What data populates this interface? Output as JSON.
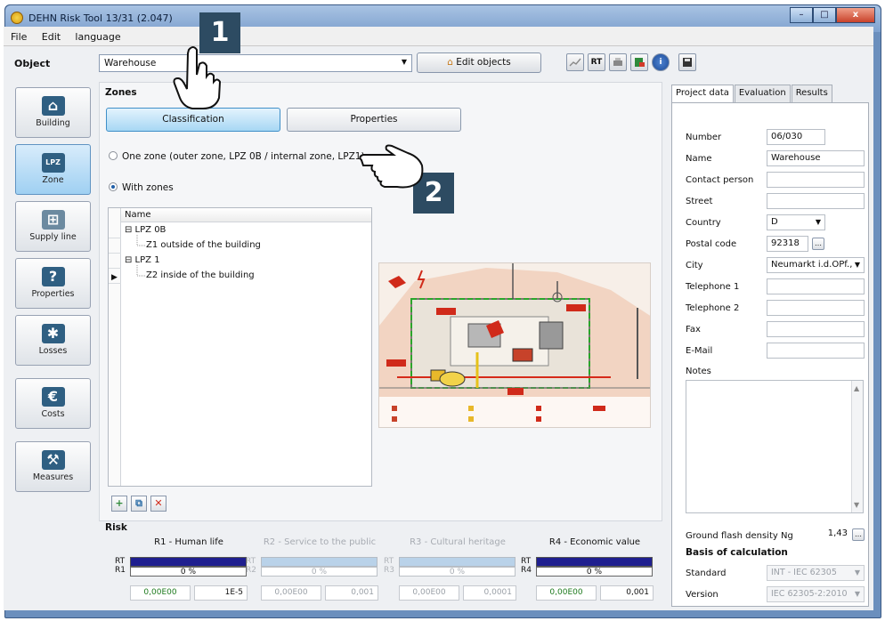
{
  "window": {
    "title": "DEHN Risk Tool 13/31 (2.047)",
    "controls": {
      "minimize": "–",
      "maximize": "□",
      "close": "x"
    }
  },
  "menu": [
    "File",
    "Edit",
    "language"
  ],
  "toolbar": {
    "object_label": "Object",
    "object_value": "Warehouse",
    "edit_objects": "Edit objects",
    "rt_label": "RT"
  },
  "sidebar": [
    {
      "label": "Building",
      "icon": "house-icon",
      "glyph": "⌂"
    },
    {
      "label": "Zone",
      "icon": "lpz-zone-icon",
      "glyph": "LPZ"
    },
    {
      "label": "Supply line",
      "icon": "supply-line-icon",
      "glyph": "⊞"
    },
    {
      "label": "Properties",
      "icon": "question-icon",
      "glyph": "?"
    },
    {
      "label": "Losses",
      "icon": "losses-icon",
      "glyph": "✱"
    },
    {
      "label": "Costs",
      "icon": "euro-icon",
      "glyph": "€"
    },
    {
      "label": "Measures",
      "icon": "wrench-icon",
      "glyph": "⚒"
    }
  ],
  "zones": {
    "heading": "Zones",
    "classification_btn": "Classification",
    "properties_btn": "Properties",
    "radio_one_zone": "One zone (outer zone, LPZ 0B / internal zone, LPZ1)",
    "radio_with_zones": "With zones",
    "tree_header": "Name",
    "tree": [
      {
        "label": "⊟ LPZ 0B",
        "indent": 0
      },
      {
        "label": "Z1 outside of the building",
        "indent": 1
      },
      {
        "label": "⊟ LPZ 1",
        "indent": 0
      },
      {
        "label": "Z2 inside of the building",
        "indent": 1
      }
    ]
  },
  "callouts": {
    "one": "1",
    "two": "2"
  },
  "risk": {
    "heading": "Risk",
    "items": [
      {
        "title": "R1 - Human life",
        "rt": "RT",
        "rn": "R1",
        "percent": "0 %",
        "value": "0,00E00",
        "limit": "1E-5",
        "active": true
      },
      {
        "title": "R2 - Service to the public",
        "rt": "RT",
        "rn": "R2",
        "percent": "0 %",
        "value": "0,00E00",
        "limit": "0,001",
        "active": false
      },
      {
        "title": "R3 - Cultural heritage",
        "rt": "RT",
        "rn": "R3",
        "percent": "0 %",
        "value": "0,00E00",
        "limit": "0,0001",
        "active": false
      },
      {
        "title": "R4 - Economic value",
        "rt": "RT",
        "rn": "R4",
        "percent": "0 %",
        "value": "0,00E00",
        "limit": "0,001",
        "active": true
      }
    ]
  },
  "right": {
    "tabs": [
      "Project data",
      "Evaluation",
      "Results"
    ],
    "fields": [
      {
        "label": "Number",
        "value": "06/030"
      },
      {
        "label": "Name",
        "value": "Warehouse"
      },
      {
        "label": "Contact person",
        "value": ""
      },
      {
        "label": "Street",
        "value": ""
      },
      {
        "label": "Country",
        "value": "D"
      },
      {
        "label": "Postal code",
        "value": "92318"
      },
      {
        "label": "City",
        "value": "Neumarkt i.d.OPf.,"
      },
      {
        "label": "Telephone 1",
        "value": ""
      },
      {
        "label": "Telephone 2",
        "value": ""
      },
      {
        "label": "Fax",
        "value": ""
      },
      {
        "label": "E-Mail",
        "value": ""
      }
    ],
    "notes_label": "Notes",
    "ground_flash_label": "Ground flash density Ng",
    "ground_flash_value": "1,43",
    "basis_heading": "Basis of calculation",
    "standard_label": "Standard",
    "standard_value": "INT - IEC 62305",
    "version_label": "Version",
    "version_value": "IEC 62305-2:2010",
    "browse_glyph": "…"
  },
  "colors": {
    "bar_active": "#1f1f8f",
    "bar_inactive": "#b9d2e9",
    "callout_bg": "#2d4b62",
    "value_green": "#1d7a1d"
  }
}
